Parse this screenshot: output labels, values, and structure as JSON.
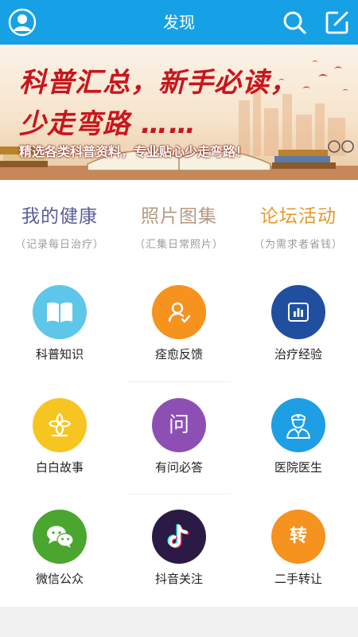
{
  "header": {
    "title": "发现",
    "bg_color": "#16a1e7",
    "icons": [
      "avatar-icon",
      "search-icon",
      "edit-icon"
    ]
  },
  "banner": {
    "line1": "科普汇总，新手必读，",
    "line2": "少走弯路 ……",
    "subtitle": "精选各类科普资料，专业贴心少走弯路！"
  },
  "quick_links": [
    {
      "title": "我的健康",
      "subtitle": "（记录每日治疗）",
      "color": "#5a5d9a"
    },
    {
      "title": "照片图集",
      "subtitle": "（汇集日常照片）",
      "color": "#b49a82"
    },
    {
      "title": "论坛活动",
      "subtitle": "（为需求者省钱）",
      "color": "#e59a2a"
    }
  ],
  "grid": [
    {
      "label": "科普知识",
      "icon": "book-icon",
      "color": "#5ec6e8"
    },
    {
      "label": "痊愈反馈",
      "icon": "user-check-icon",
      "color": "#f6921e"
    },
    {
      "label": "治疗经验",
      "icon": "chart-icon",
      "color": "#1f4f9e"
    },
    {
      "label": "白白故事",
      "icon": "flower-icon",
      "color": "#f7c522"
    },
    {
      "label": "有问必答",
      "icon": "question-icon",
      "glyph": "问",
      "color": "#8e4fb4"
    },
    {
      "label": "医院医生",
      "icon": "doctor-icon",
      "color": "#1e9ee5"
    },
    {
      "label": "微信公众",
      "icon": "wechat-icon",
      "color": "#4aa62e"
    },
    {
      "label": "抖音关注",
      "icon": "tiktok-icon",
      "color": "#2b1a46"
    },
    {
      "label": "二手转让",
      "icon": "transfer-icon",
      "glyph": "转",
      "color": "#f6921e"
    }
  ]
}
